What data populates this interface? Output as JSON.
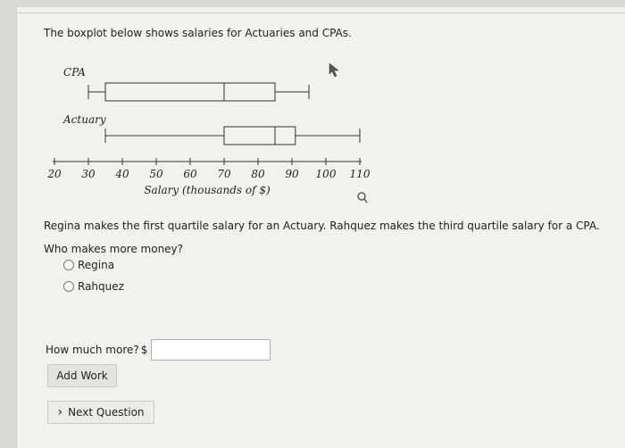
{
  "question": {
    "intro": "The boxplot below shows salaries for Actuaries and CPAs.",
    "prompt": "Regina makes the first quartile salary for an Actuary. Rahquez makes the third quartile salary for a CPA.",
    "ask": "Who makes more money?",
    "options": [
      "Regina",
      "Rahquez"
    ],
    "more_label": "How much more?",
    "currency": "$",
    "more_value": ""
  },
  "buttons": {
    "add_work": "Add Work",
    "next_question": "Next Question",
    "next_glyph": "›"
  },
  "chart_data": {
    "type": "boxplot",
    "xlabel": "Salary (thousands of $)",
    "xlim": [
      20,
      110
    ],
    "ticks": [
      20,
      30,
      40,
      50,
      60,
      70,
      80,
      90,
      100,
      110
    ],
    "series": [
      {
        "name": "CPA",
        "min": 30,
        "q1": 35,
        "median": 70,
        "q3": 85,
        "max": 95
      },
      {
        "name": "Actuary",
        "min": 35,
        "q1": 70,
        "median": 85,
        "q3": 91,
        "max": 110
      }
    ]
  },
  "icons": {
    "cursor": "arrow-cursor-icon",
    "magnifier": "magnifier-icon"
  }
}
